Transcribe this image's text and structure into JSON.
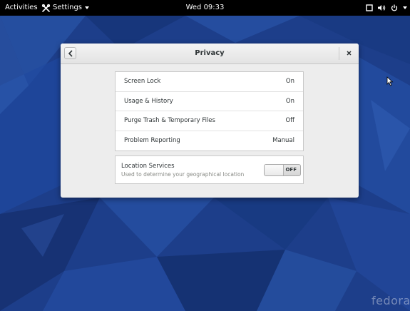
{
  "topbar": {
    "activities": "Activities",
    "app_name": "Settings",
    "clock": "Wed 09:33"
  },
  "window": {
    "title": "Privacy",
    "rows": [
      {
        "label": "Screen Lock",
        "value": "On"
      },
      {
        "label": "Usage & History",
        "value": "On"
      },
      {
        "label": "Purge Trash & Temporary Files",
        "value": "Off"
      },
      {
        "label": "Problem Reporting",
        "value": "Manual"
      }
    ],
    "location": {
      "title": "Location Services",
      "subtitle": "Used to determine your geographical location",
      "switch_state": "OFF"
    }
  },
  "desktop": {
    "logo_text": "fedora"
  },
  "colors": {
    "wallpaper": "#1d3e8a",
    "topbar": "#000000",
    "window_bg": "#ededed",
    "text": "#2e3436",
    "subtext": "#888a85"
  },
  "icons": {
    "app": "settings-tools-icon",
    "back": "chevron-left-icon",
    "close": "close-icon",
    "status": [
      "screen-icon",
      "volume-icon",
      "power-icon",
      "chevron-down-icon"
    ]
  }
}
